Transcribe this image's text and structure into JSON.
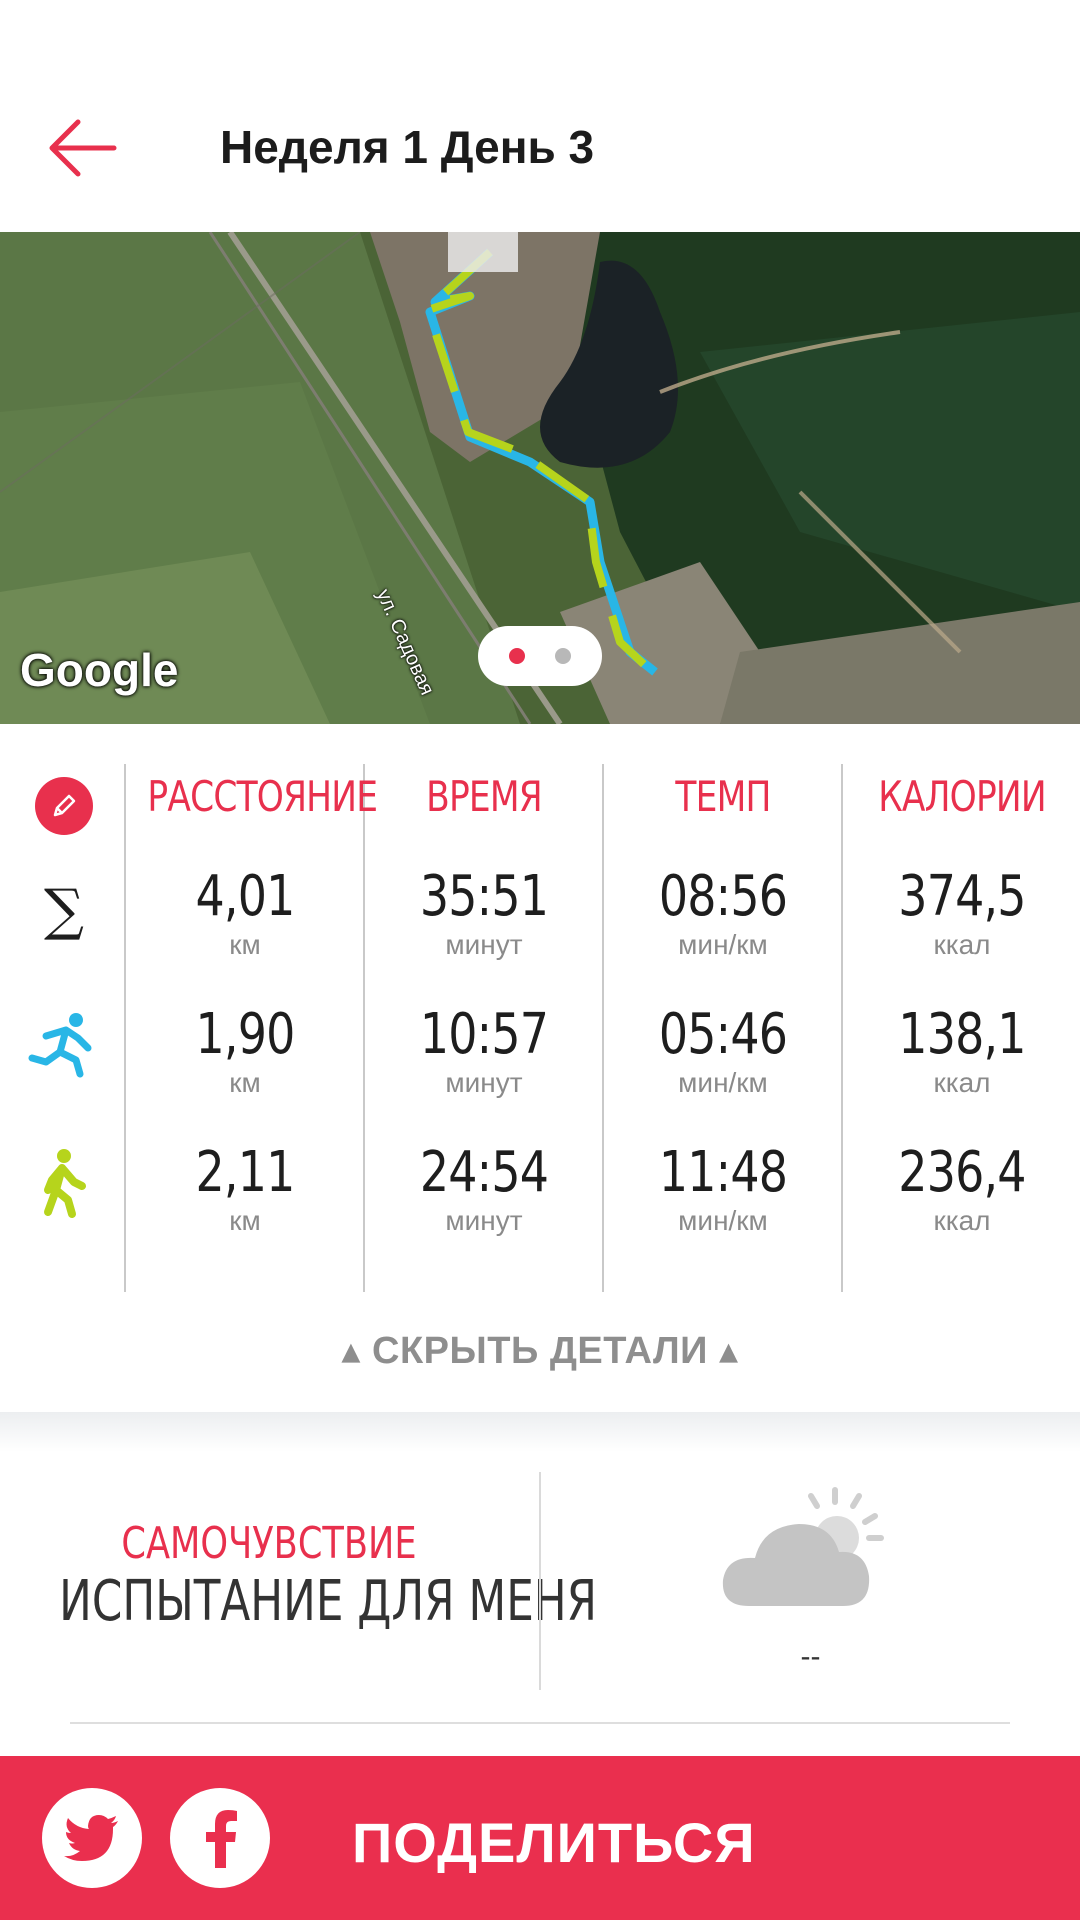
{
  "header": {
    "title": "Неделя 1 День 3",
    "back_icon": "arrow-left-icon"
  },
  "map": {
    "provider_logo": "Google",
    "street_label": "ул. Садовая",
    "pages": 2,
    "active_page": 1
  },
  "stats": {
    "columns": [
      "РАССТОЯНИЕ",
      "ВРЕМЯ",
      "ТЕМП",
      "КАЛОРИИ"
    ],
    "rows": [
      {
        "icon": "sigma-icon",
        "symbol": "∑",
        "cells": [
          {
            "value": "4,01",
            "unit": "км"
          },
          {
            "value": "35:51",
            "unit": "минут"
          },
          {
            "value": "08:56",
            "unit": "мин/км"
          },
          {
            "value": "374,5",
            "unit": "ккал"
          }
        ]
      },
      {
        "icon": "running-icon",
        "cells": [
          {
            "value": "1,90",
            "unit": "км"
          },
          {
            "value": "10:57",
            "unit": "минут"
          },
          {
            "value": "05:46",
            "unit": "мин/км"
          },
          {
            "value": "138,1",
            "unit": "ккал"
          }
        ]
      },
      {
        "icon": "walking-icon",
        "cells": [
          {
            "value": "2,11",
            "unit": "км"
          },
          {
            "value": "24:54",
            "unit": "минут"
          },
          {
            "value": "11:48",
            "unit": "мин/км"
          },
          {
            "value": "236,4",
            "unit": "ккал"
          }
        ]
      }
    ],
    "hide_details_label": "СКРЫТЬ ДЕТАЛИ"
  },
  "feeling": {
    "label": "САМОЧУВСТВИЕ",
    "value": "ИСПЫТАНИЕ ДЛЯ МЕНЯ"
  },
  "weather": {
    "icon": "partly-cloudy-icon",
    "value": "--"
  },
  "share": {
    "label": "ПОДЕЛИТЬСЯ"
  },
  "colors": {
    "accent": "#e8304d",
    "run_route": "#29b6e6",
    "walk_route": "#b6d41c"
  }
}
